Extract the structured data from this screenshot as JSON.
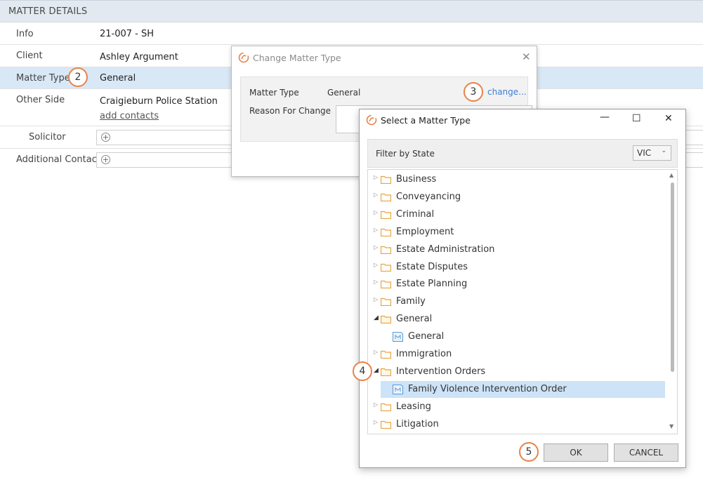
{
  "panel": {
    "title": "MATTER DETAILS",
    "rows": {
      "info": {
        "label": "Info",
        "value": "21-007 - SH"
      },
      "client": {
        "label": "Client",
        "value": "Ashley Argument"
      },
      "matter_type": {
        "label": "Matter Type",
        "value": "General"
      },
      "other_side": {
        "label": "Other Side",
        "value": "Craigieburn Police Station",
        "link": "add contacts"
      },
      "solicitor": {
        "label": "Solicitor"
      },
      "additional_contact": {
        "label": "Additional Contact"
      }
    },
    "plus_glyph": "+"
  },
  "callouts": {
    "c2": "2",
    "c3": "3",
    "c4": "4",
    "c5": "5"
  },
  "change_dialog": {
    "title": "Change Matter Type",
    "close": "✕",
    "matter_type_label": "Matter Type",
    "matter_type_value": "General",
    "reason_label": "Reason For Change",
    "change_link": "change..."
  },
  "select_dialog": {
    "title": "Select a Matter Type",
    "minimize": "—",
    "maximize": "☐",
    "close": "✕",
    "filter_label": "Filter by State",
    "state_value": "VIC",
    "tree": [
      {
        "label": "Business",
        "type": "folder"
      },
      {
        "label": "Conveyancing",
        "type": "folder"
      },
      {
        "label": "Criminal",
        "type": "folder"
      },
      {
        "label": "Employment",
        "type": "folder"
      },
      {
        "label": "Estate Administration",
        "type": "folder"
      },
      {
        "label": "Estate Disputes",
        "type": "folder"
      },
      {
        "label": "Estate Planning",
        "type": "folder"
      },
      {
        "label": "Family",
        "type": "folder"
      },
      {
        "label": "General",
        "type": "folder",
        "expanded": true
      },
      {
        "label": "General",
        "type": "matter"
      },
      {
        "label": "Immigration",
        "type": "folder"
      },
      {
        "label": "Intervention Orders",
        "type": "folder",
        "expanded": true
      },
      {
        "label": "Family Violence Intervention Order",
        "type": "matter",
        "selected": true
      },
      {
        "label": "Leasing",
        "type": "folder"
      },
      {
        "label": "Litigation",
        "type": "folder"
      }
    ],
    "ok_label": "OK",
    "cancel_label": "CANCEL"
  },
  "colors": {
    "accent": "#e8834a",
    "selection": "#cde3f7",
    "link": "#3d7fd1",
    "folder": "#e8a33c"
  }
}
